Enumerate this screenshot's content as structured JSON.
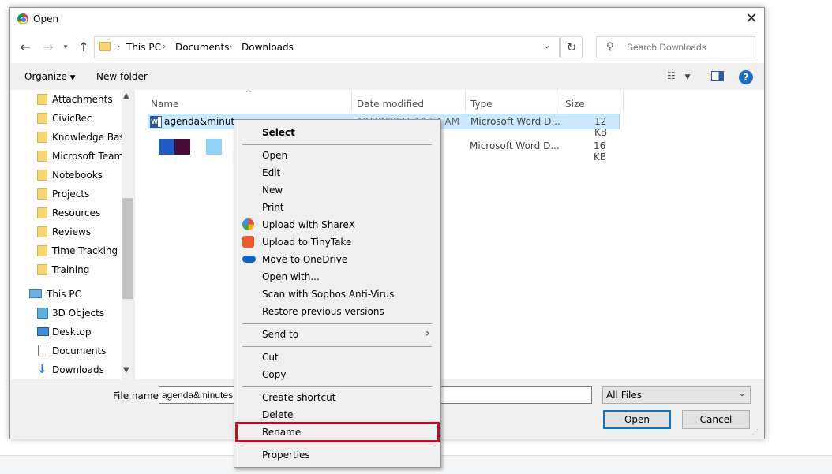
{
  "window": {
    "title": "Open"
  },
  "address": {
    "crumbs": [
      "This PC",
      "Documents",
      "Downloads"
    ]
  },
  "search": {
    "placeholder": "Search Downloads"
  },
  "toolbar": {
    "organize": "Organize",
    "new_folder": "New folder"
  },
  "navpane": {
    "folders": [
      "Attachments",
      "CivicRec",
      "Knowledge Base",
      "Microsoft Teams",
      "Notebooks",
      "Projects",
      "Resources",
      "Reviews",
      "Time Tracking",
      "Training"
    ],
    "this_pc": "This PC",
    "pc_items": [
      "3D Objects",
      "Desktop",
      "Documents",
      "Downloads"
    ]
  },
  "columns": {
    "name": "Name",
    "date": "Date modified",
    "type": "Type",
    "size": "Size"
  },
  "files": [
    {
      "name": "agenda&minutes",
      "date": "10/20/2021 10:54 AM",
      "type": "Microsoft Word D...",
      "size": "12 KB",
      "selected": true
    },
    {
      "name": "",
      "date": "",
      "type": "Microsoft Word D...",
      "size": "16 KB",
      "selected": false
    }
  ],
  "bottom": {
    "file_name_label": "File name:",
    "file_name_value": "agenda&minutes",
    "filter": "All Files",
    "open_label": "Open",
    "cancel_label": "Cancel"
  },
  "context_menu": {
    "groups": [
      [
        "Select"
      ],
      [
        "Open",
        "Edit",
        "New",
        "Print",
        "Upload with ShareX",
        "Upload to TinyTake",
        "Move to OneDrive",
        "Open with...",
        "Scan with Sophos Anti-Virus",
        "Restore previous versions"
      ],
      [
        "Send to"
      ],
      [
        "Cut",
        "Copy"
      ],
      [
        "Create shortcut",
        "Delete",
        "Rename"
      ],
      [
        "Properties"
      ]
    ],
    "highlighted": "Rename",
    "highlight_color": "#c00a2a"
  },
  "colors": {
    "selection_bg": "#cce8ff",
    "accent": "#0078d7",
    "folder": "#f6d66e"
  }
}
